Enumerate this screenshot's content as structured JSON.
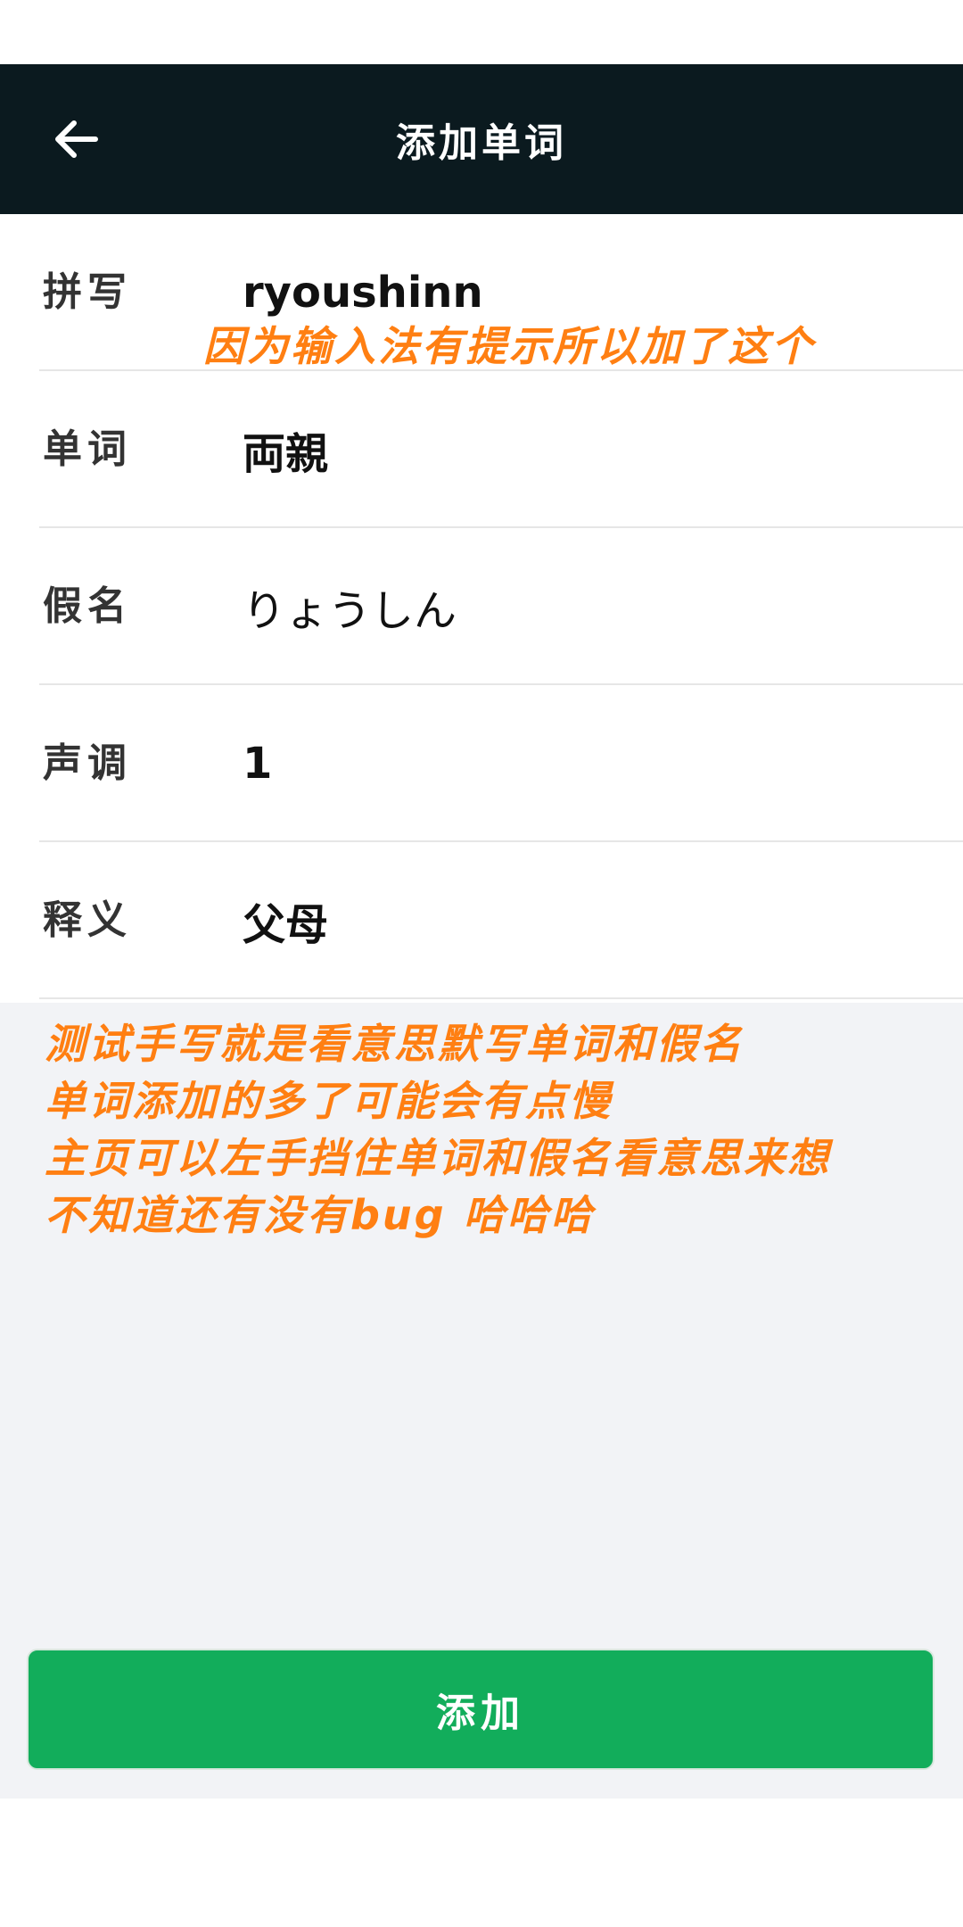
{
  "header": {
    "title": "添加单词",
    "back_icon": "arrow-left-icon"
  },
  "form": {
    "fields": [
      {
        "label": "拼写",
        "value": "ryoushinn"
      },
      {
        "label": "单词",
        "value": "両親"
      },
      {
        "label": "假名",
        "value": "りょうしん"
      },
      {
        "label": "声调",
        "value": "1"
      },
      {
        "label": "释义",
        "value": "父母"
      }
    ]
  },
  "annotations": {
    "top": "因为输入法有提示所以加了这个",
    "lines": [
      "测试手写就是看意思默写单词和假名",
      "单词添加的多了可能会有点慢",
      "主页可以左手挡住单词和假名看意思来想",
      "不知道还有没有bug 哈哈哈"
    ]
  },
  "submit": {
    "label": "添加"
  },
  "colors": {
    "appbar": "#0b1a1f",
    "button": "#12ad5b",
    "annotation": "#ff7f12"
  }
}
